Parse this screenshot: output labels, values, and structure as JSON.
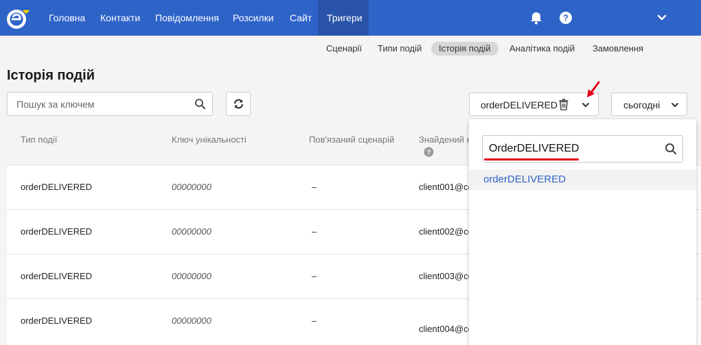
{
  "nav": {
    "items": [
      "Головна",
      "Контакти",
      "Повідомлення",
      "Розсилки",
      "Сайт",
      "Тригери"
    ],
    "active": "Тригери",
    "notifications_icon": "bell-icon",
    "help_icon": "question-circle-icon",
    "account_icon": "chevron-down-icon"
  },
  "subtabs": [
    "Сценарії",
    "Типи подій",
    "Історія подій",
    "Аналітика подій",
    "Замовлення"
  ],
  "subtab_active": "Історія подій",
  "page_title": "Історія подій",
  "search": {
    "placeholder": "Пошук за ключем",
    "value": ""
  },
  "filters": {
    "event_type_value": "orderDELIVERED",
    "date_value": "сьогодні"
  },
  "table": {
    "headers": [
      "Тип події",
      "Ключ унікальності",
      "Пов'язаний сценарій",
      "Знайдений к"
    ],
    "rows": [
      {
        "type": "orderDELIVERED",
        "key": "00000000",
        "scenario": "–",
        "found": "client001@co"
      },
      {
        "type": "orderDELIVERED",
        "key": "00000000",
        "scenario": "–",
        "found": "client002@co"
      },
      {
        "type": "orderDELIVERED",
        "key": "00000000",
        "scenario": "–",
        "found": "client003@co"
      },
      {
        "type": "orderDELIVERED",
        "key": "00000000",
        "scenario": "–",
        "found": "client004@co"
      }
    ]
  },
  "dropdown": {
    "search_value": "OrderDELIVERED",
    "options": [
      "orderDELIVERED"
    ]
  },
  "colors": {
    "brand": "#2e63c8",
    "annotation": "#e3001b"
  }
}
